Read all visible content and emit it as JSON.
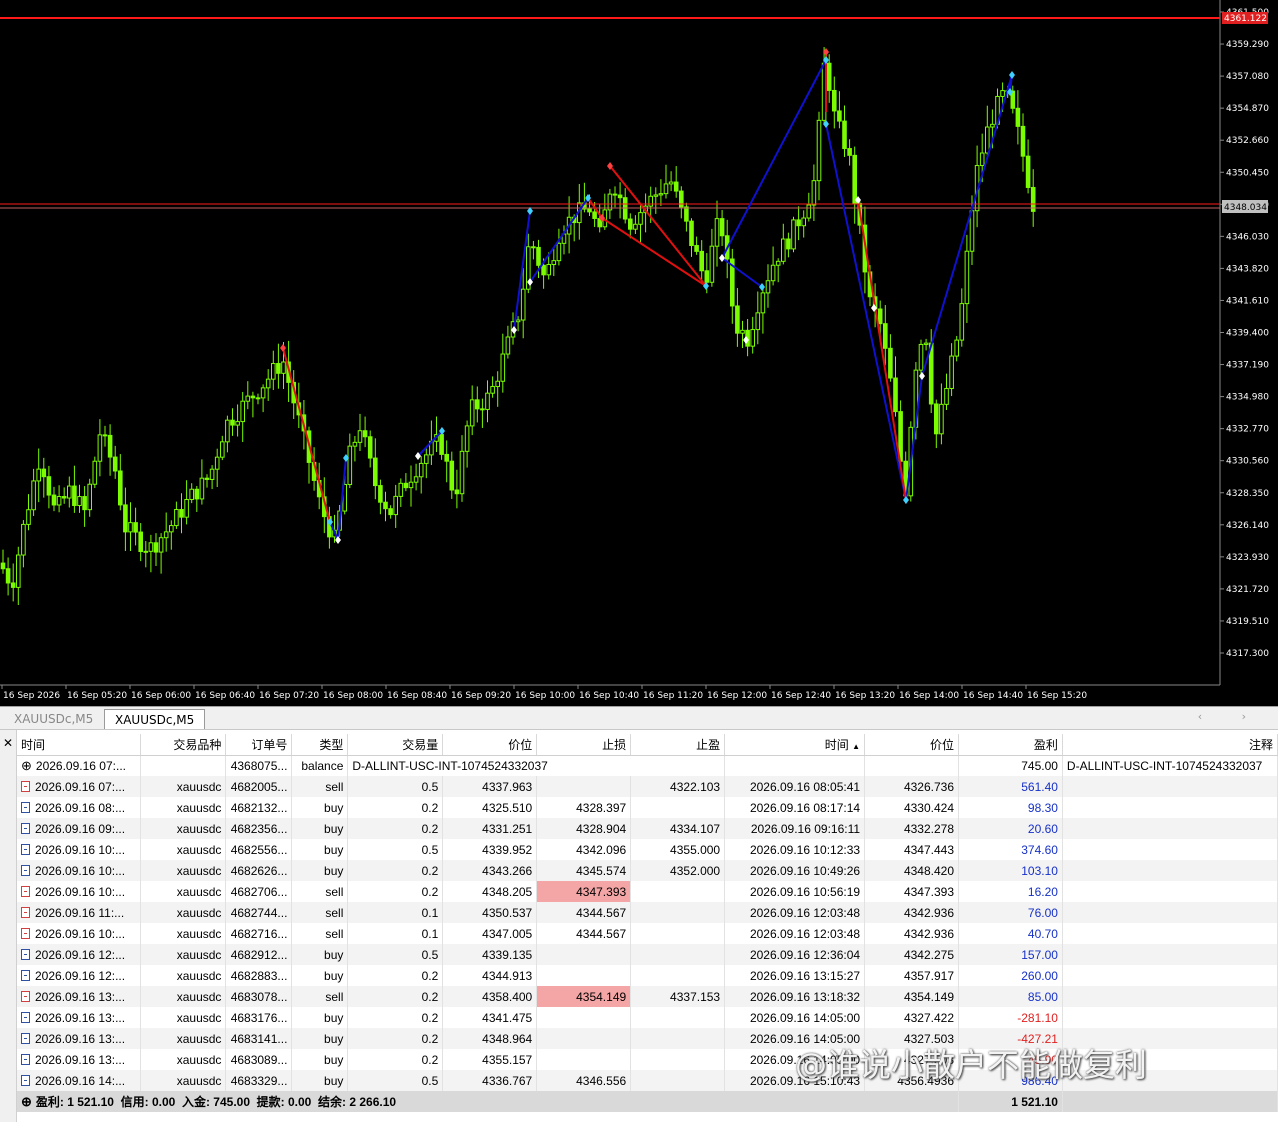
{
  "chart": {
    "symbol": "XAUUSDc",
    "timeframe": "M5",
    "price_ticks": [
      "4361.500",
      "4359.290",
      "4357.080",
      "4354.870",
      "4352.660",
      "4350.450",
      "4348.240",
      "4346.030",
      "4343.820",
      "4341.610",
      "4339.400",
      "4337.190",
      "4334.980",
      "4332.770",
      "4330.560",
      "4328.350",
      "4326.140",
      "4323.930",
      "4321.720",
      "4319.510",
      "4317.300"
    ],
    "time_ticks": [
      "16 Sep 2026",
      "16 Sep 05:20",
      "16 Sep 06:00",
      "16 Sep 06:40",
      "16 Sep 07:20",
      "16 Sep 08:00",
      "16 Sep 08:40",
      "16 Sep 09:20",
      "16 Sep 10:00",
      "16 Sep 10:40",
      "16 Sep 11:20",
      "16 Sep 12:00",
      "16 Sep 12:40",
      "16 Sep 13:20",
      "16 Sep 14:00",
      "16 Sep 14:40",
      "16 Sep 15:20"
    ],
    "upper_line_label": "4361.122",
    "current_price_label": "4348.034",
    "colors": {
      "background": "#000000",
      "candle": "#7CFC00",
      "red_line": "#ff1a1a",
      "blue_line": "#1010d0",
      "red_trade": "#e01010",
      "axis_text": "#ffffff"
    }
  },
  "tabs": [
    {
      "label": "XAUUSDc,M5"
    },
    {
      "label": "XAUUSDc,M5"
    }
  ],
  "tab_arrows": "‹ ›",
  "close_glyph": "✕",
  "columns": [
    "时间",
    "交易品种",
    "订单号",
    "类型",
    "交易量",
    "价位",
    "止损",
    "止盈",
    "时间",
    "价位",
    "盈利",
    "注释"
  ],
  "balance_row": {
    "time": "2026.09.16 07:...",
    "order": "4368075...",
    "type": "balance",
    "comment": "D-ALLINT-USC-INT-1074524332037",
    "profit": "745.00",
    "note": "D-ALLINT-USC-INT-1074524332037"
  },
  "rows": [
    {
      "time": "2026.09.16 07:...",
      "symbol": "xauusdc",
      "order": "4682005...",
      "type": "sell",
      "volume": "0.5",
      "price": "4337.963",
      "sl": "",
      "tp": "4322.103",
      "close_time": "2026.09.16 08:05:41",
      "close_price": "4326.736",
      "profit": "561.40"
    },
    {
      "time": "2026.09.16 08:...",
      "symbol": "xauusdc",
      "order": "4682132...",
      "type": "buy",
      "volume": "0.2",
      "price": "4325.510",
      "sl": "4328.397",
      "tp": "",
      "close_time": "2026.09.16 08:17:14",
      "close_price": "4330.424",
      "profit": "98.30"
    },
    {
      "time": "2026.09.16 09:...",
      "symbol": "xauusdc",
      "order": "4682356...",
      "type": "buy",
      "volume": "0.2",
      "price": "4331.251",
      "sl": "4328.904",
      "tp": "4334.107",
      "close_time": "2026.09.16 09:16:11",
      "close_price": "4332.278",
      "profit": "20.60"
    },
    {
      "time": "2026.09.16 10:...",
      "symbol": "xauusdc",
      "order": "4682556...",
      "type": "buy",
      "volume": "0.5",
      "price": "4339.952",
      "sl": "4342.096",
      "tp": "4355.000",
      "close_time": "2026.09.16 10:12:33",
      "close_price": "4347.443",
      "profit": "374.60"
    },
    {
      "time": "2026.09.16 10:...",
      "symbol": "xauusdc",
      "order": "4682626...",
      "type": "buy",
      "volume": "0.2",
      "price": "4343.266",
      "sl": "4345.574",
      "tp": "4352.000",
      "close_time": "2026.09.16 10:49:26",
      "close_price": "4348.420",
      "profit": "103.10"
    },
    {
      "time": "2026.09.16 10:...",
      "symbol": "xauusdc",
      "order": "4682706...",
      "type": "sell",
      "volume": "0.2",
      "price": "4348.205",
      "sl": "4347.393",
      "tp": "",
      "close_time": "2026.09.16 10:56:19",
      "close_price": "4347.393",
      "profit": "16.20"
    },
    {
      "time": "2026.09.16 11:...",
      "symbol": "xauusdc",
      "order": "4682744...",
      "type": "sell",
      "volume": "0.1",
      "price": "4350.537",
      "sl": "4344.567",
      "tp": "",
      "close_time": "2026.09.16 12:03:48",
      "close_price": "4342.936",
      "profit": "76.00"
    },
    {
      "time": "2026.09.16 10:...",
      "symbol": "xauusdc",
      "order": "4682716...",
      "type": "sell",
      "volume": "0.1",
      "price": "4347.005",
      "sl": "4344.567",
      "tp": "",
      "close_time": "2026.09.16 12:03:48",
      "close_price": "4342.936",
      "profit": "40.70"
    },
    {
      "time": "2026.09.16 12:...",
      "symbol": "xauusdc",
      "order": "4682912...",
      "type": "buy",
      "volume": "0.5",
      "price": "4339.135",
      "sl": "",
      "tp": "",
      "close_time": "2026.09.16 12:36:04",
      "close_price": "4342.275",
      "profit": "157.00"
    },
    {
      "time": "2026.09.16 12:...",
      "symbol": "xauusdc",
      "order": "4682883...",
      "type": "buy",
      "volume": "0.2",
      "price": "4344.913",
      "sl": "",
      "tp": "",
      "close_time": "2026.09.16 13:15:27",
      "close_price": "4357.917",
      "profit": "260.00"
    },
    {
      "time": "2026.09.16 13:...",
      "symbol": "xauusdc",
      "order": "4683078...",
      "type": "sell",
      "volume": "0.2",
      "price": "4358.400",
      "sl": "4354.149",
      "tp": "4337.153",
      "close_time": "2026.09.16 13:18:32",
      "close_price": "4354.149",
      "profit": "85.00"
    },
    {
      "time": "2026.09.16 13:...",
      "symbol": "xauusdc",
      "order": "4683176...",
      "type": "buy",
      "volume": "0.2",
      "price": "4341.475",
      "sl": "",
      "tp": "",
      "close_time": "2026.09.16 14:05:00",
      "close_price": "4327.422",
      "profit": "-281.10"
    },
    {
      "time": "2026.09.16 13:...",
      "symbol": "xauusdc",
      "order": "4683141...",
      "type": "buy",
      "volume": "0.2",
      "price": "4348.964",
      "sl": "",
      "tp": "",
      "close_time": "2026.09.16 14:05:00",
      "close_price": "4327.503",
      "profit": "-427.21"
    },
    {
      "time": "2026.09.16 13:...",
      "symbol": "xauusdc",
      "order": "4683089...",
      "type": "buy",
      "volume": "0.2",
      "price": "4355.157",
      "sl": "",
      "tp": "",
      "close_time": "2026.09.16 14:05:00",
      "close_price": "4327.503",
      "profit": "-45.90"
    },
    {
      "time": "2026.09.16 14:...",
      "symbol": "xauusdc",
      "order": "4683329...",
      "type": "buy",
      "volume": "0.5",
      "price": "4336.767",
      "sl": "4346.556",
      "tp": "",
      "close_time": "2026.09.16 15:10:43",
      "close_price": "4356.4936",
      "profit": "986.40"
    }
  ],
  "highlight_sl": [
    "4347.393",
    "4354.149"
  ],
  "summary": {
    "text": "盈利: 1 521.10  信用: 0.00  入金: 745.00  提款: 0.00  结余: 2 266.10",
    "profit": "1 521.10"
  },
  "watermark": "@谁说小散户不能做复利"
}
